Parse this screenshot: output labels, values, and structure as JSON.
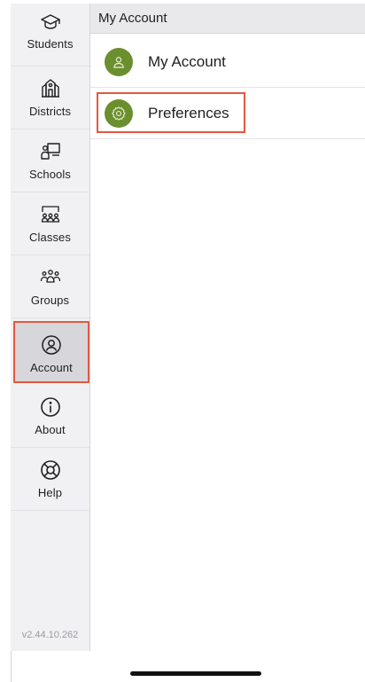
{
  "sidebar": {
    "items": [
      {
        "label": "Students",
        "icon": "graduation-cap-icon"
      },
      {
        "label": "Districts",
        "icon": "district-building-icon"
      },
      {
        "label": "Schools",
        "icon": "school-presentation-icon"
      },
      {
        "label": "Classes",
        "icon": "classroom-icon"
      },
      {
        "label": "Groups",
        "icon": "group-people-icon"
      },
      {
        "label": "Account",
        "icon": "account-circle-icon",
        "selected": true
      },
      {
        "label": "About",
        "icon": "info-circle-icon"
      },
      {
        "label": "Help",
        "icon": "lifebuoy-icon"
      }
    ],
    "version": "v2.44.10.262"
  },
  "main": {
    "header_title": "My Account",
    "rows": [
      {
        "label": "My Account",
        "icon": "person-icon"
      },
      {
        "label": "Preferences",
        "icon": "gear-icon",
        "highlighted": true
      }
    ]
  },
  "colors": {
    "accent_green": "#6b8f2e",
    "highlight_border": "#e5573f",
    "sidebar_bg": "#f1f1f3",
    "selected_bg": "#d7d7db"
  }
}
